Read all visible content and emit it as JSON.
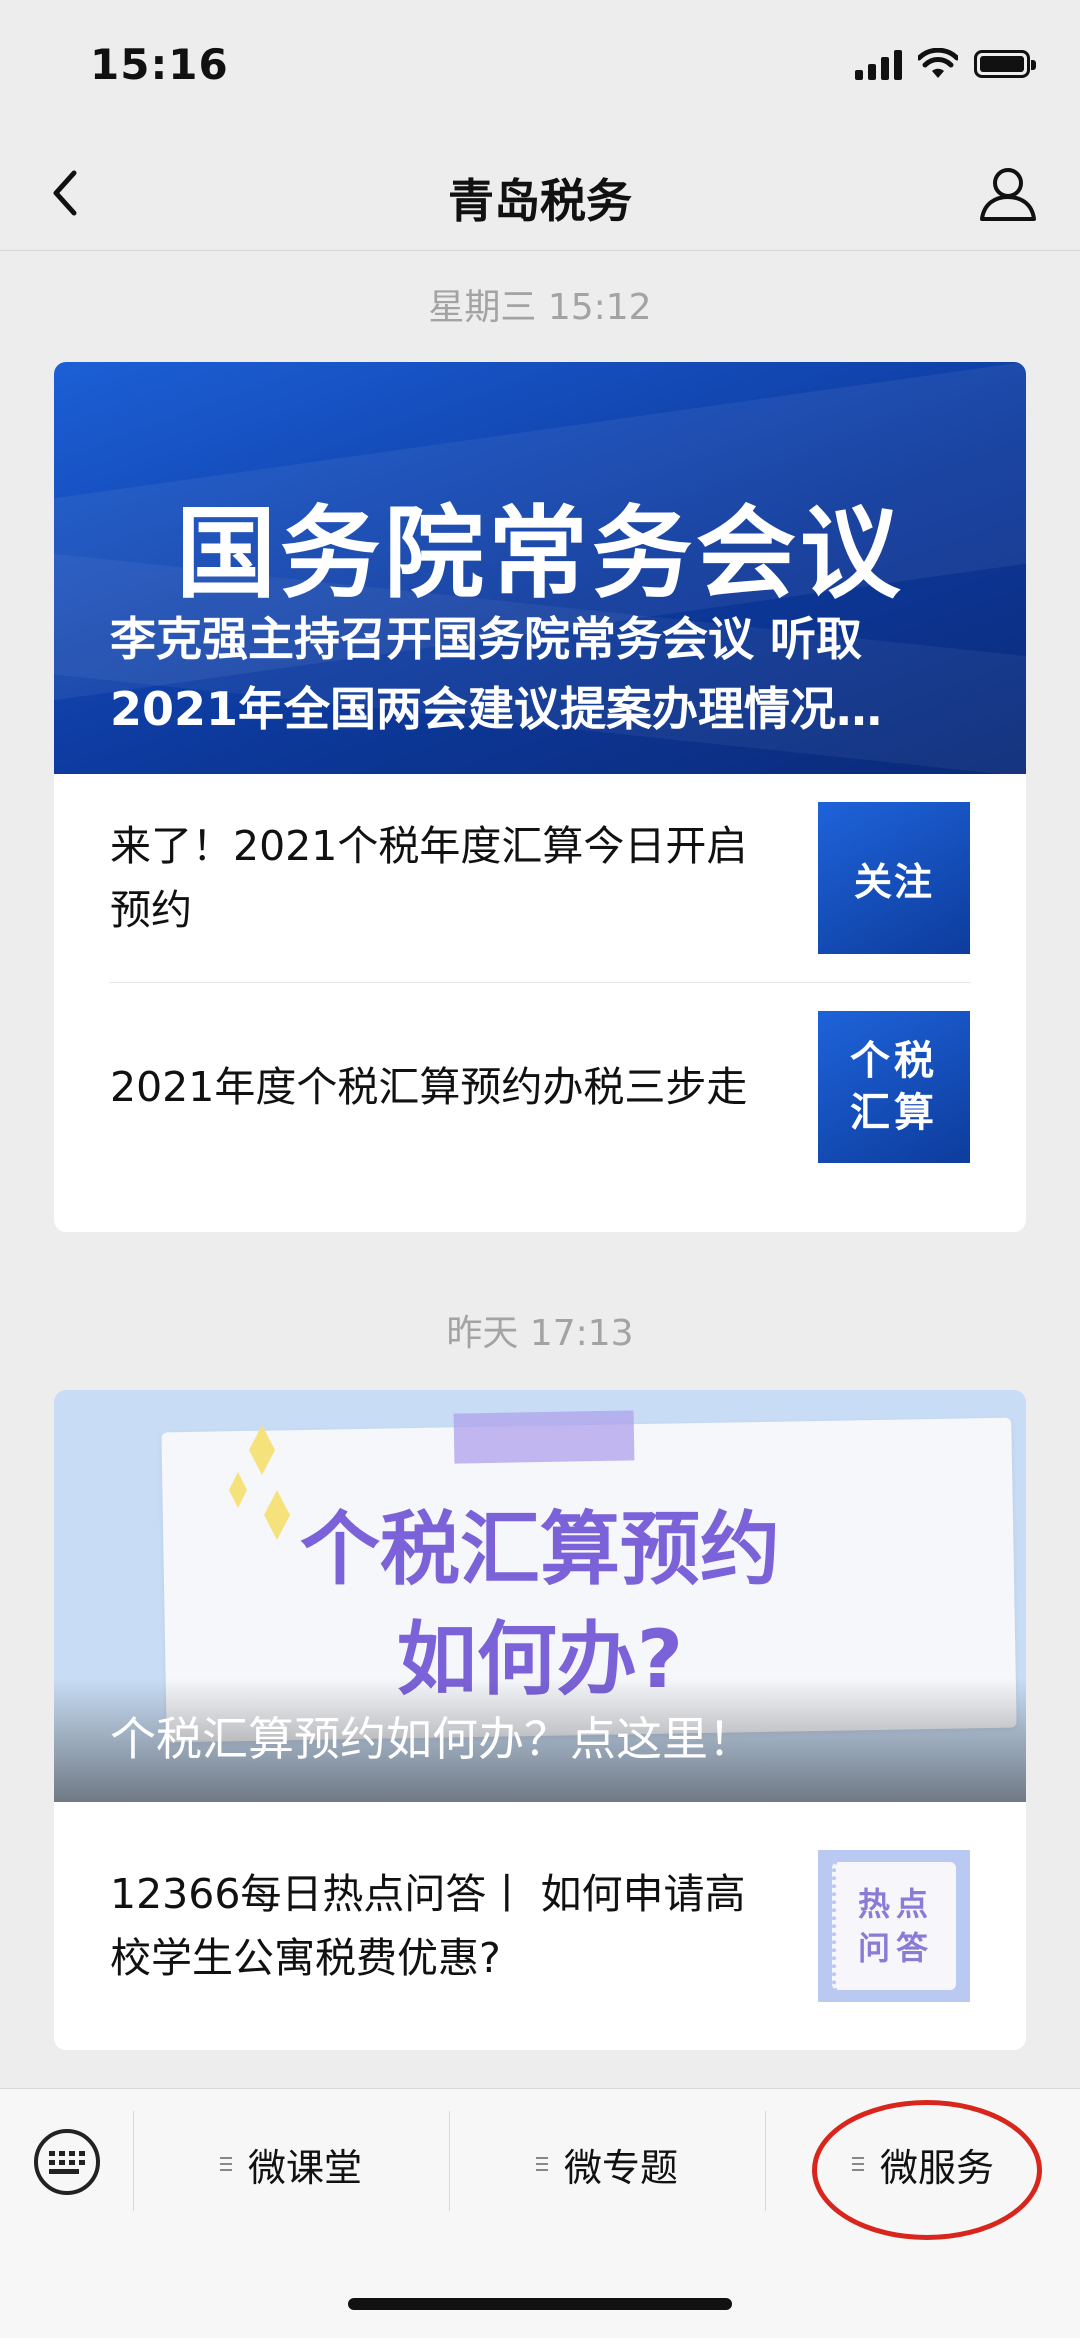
{
  "status_bar": {
    "time": "15:16"
  },
  "nav": {
    "title": "青岛税务"
  },
  "messages": [
    {
      "timestamp": "星期三 15:12",
      "hero": {
        "headline": "国务院常务会议",
        "caption": "李克强主持召开国务院常务会议 听取2021年全国两会建议提案办理情况…"
      },
      "items": [
        {
          "title": "来了！2021个税年度汇算今日开启预约",
          "thumb_text": "关注"
        },
        {
          "title": "2021年度个税汇算预约办税三步走",
          "thumb_text_line1": "个税",
          "thumb_text_line2": "汇算"
        }
      ]
    },
    {
      "timestamp": "昨天 17:13",
      "hero": {
        "headline_line1": "个税汇算预约",
        "headline_line2": "如何办?",
        "caption": "个税汇算预约如何办？点这里！"
      },
      "items": [
        {
          "title": "12366每日热点问答丨 如何申请高校学生公寓税费优惠?",
          "thumb_text_line1": "热点",
          "thumb_text_line2": "问答"
        }
      ]
    }
  ],
  "bottom_menu": {
    "items": [
      {
        "label": "微课堂"
      },
      {
        "label": "微专题"
      },
      {
        "label": "微服务"
      }
    ]
  },
  "colors": {
    "accent_blue": "#0d3a9e",
    "highlight_ring": "#d8261c",
    "background": "#ededed"
  },
  "icons": [
    "back-chevron-icon",
    "profile-icon",
    "keyboard-icon",
    "menu-list-icon"
  ]
}
